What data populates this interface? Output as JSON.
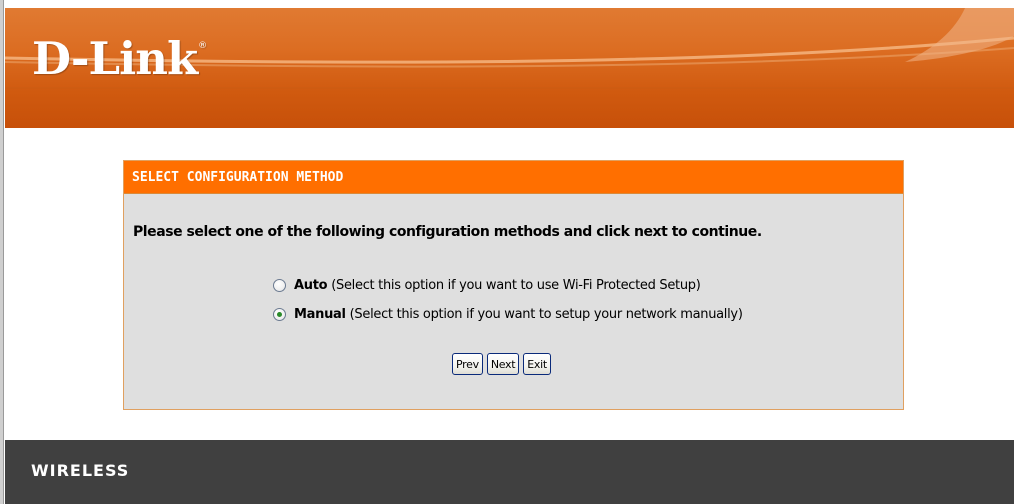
{
  "header": {
    "logo_text": "D-Link",
    "logo_mark": "®",
    "brand_color": "#dc6d22"
  },
  "panel": {
    "title": "SELECT CONFIGURATION METHOD",
    "instruction": "Please select one of the following configuration methods and click next to continue.",
    "options": [
      {
        "name": "Auto",
        "description": "(Select this option if you want to use Wi-Fi Protected Setup)",
        "selected": false
      },
      {
        "name": "Manual",
        "description": "(Select this option if you want to setup your network manually)",
        "selected": true
      }
    ],
    "buttons": {
      "prev": "Prev",
      "next": "Next",
      "exit": "Exit"
    },
    "title_color": "#ff6f00",
    "body_color": "#dfdfdf"
  },
  "footer": {
    "label": "WIRELESS",
    "color": "#404040"
  }
}
